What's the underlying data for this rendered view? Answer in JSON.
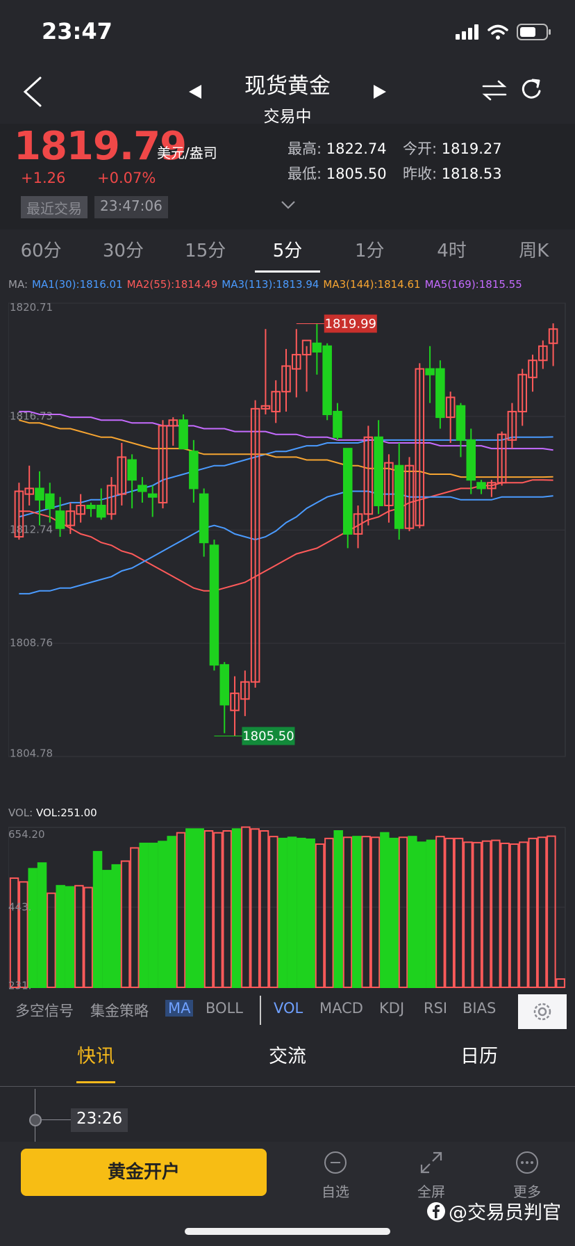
{
  "status_bar": {
    "time": "23:47"
  },
  "nav": {
    "title": "现货黄金",
    "subtitle": "交易中"
  },
  "quote": {
    "price": "1819.79",
    "unit": "美元/盎司",
    "change": "+1.26",
    "change_pct": "+0.07%",
    "last_trade_label": "最近交易",
    "last_trade_time": "23:47:06",
    "high_label": "最高:",
    "high": "1822.74",
    "open_label": "今开:",
    "open": "1819.27",
    "low_label": "最低:",
    "low": "1805.50",
    "prev_close_label": "昨收:",
    "prev_close": "1818.53"
  },
  "timeframes": [
    "60分",
    "30分",
    "15分",
    "5分",
    "1分",
    "4时",
    "周K"
  ],
  "active_timeframe": 3,
  "ma_legend": {
    "prefix": "MA:",
    "items": [
      {
        "text": "MA1(30):1816.01",
        "color": "#4a9bff"
      },
      {
        "text": "MA2(55):1814.49",
        "color": "#ff5a5a"
      },
      {
        "text": "MA3(113):1813.94",
        "color": "#4a9bff"
      },
      {
        "text": "MA3(144):1814.61",
        "color": "#f7a531"
      },
      {
        "text": "MA5(169):1815.55",
        "color": "#c56bff"
      }
    ]
  },
  "chart_data": [
    {
      "type": "candlestick",
      "ylim": [
        1804.78,
        1820.71
      ],
      "y_ticks": [
        "1820.71",
        "1816.73",
        "1812.74",
        "1808.76",
        "1804.78"
      ],
      "y_tick_values": [
        1820.71,
        1816.73,
        1812.74,
        1808.76,
        1804.78
      ],
      "max_label": "1819.99",
      "min_label": "1805.50",
      "max_value": 1819.99,
      "min_value": 1805.5,
      "max_index": 27,
      "min_index": 19,
      "candles": [
        {
          "o": 1812.5,
          "h": 1814.4,
          "l": 1812.4,
          "c": 1814.1
        },
        {
          "o": 1814.0,
          "h": 1815.0,
          "l": 1813.6,
          "c": 1814.2
        },
        {
          "o": 1814.2,
          "h": 1814.8,
          "l": 1812.9,
          "c": 1813.8
        },
        {
          "o": 1814.0,
          "h": 1814.4,
          "l": 1813.0,
          "c": 1813.5
        },
        {
          "o": 1813.4,
          "h": 1813.9,
          "l": 1812.5,
          "c": 1812.8
        },
        {
          "o": 1812.9,
          "h": 1813.7,
          "l": 1812.6,
          "c": 1813.4
        },
        {
          "o": 1813.3,
          "h": 1814.0,
          "l": 1813.0,
          "c": 1813.6
        },
        {
          "o": 1813.6,
          "h": 1813.7,
          "l": 1813.2,
          "c": 1813.5
        },
        {
          "o": 1813.6,
          "h": 1814.2,
          "l": 1813.1,
          "c": 1813.2
        },
        {
          "o": 1813.3,
          "h": 1814.6,
          "l": 1813.1,
          "c": 1814.3
        },
        {
          "o": 1814.0,
          "h": 1815.8,
          "l": 1813.6,
          "c": 1815.3
        },
        {
          "o": 1815.2,
          "h": 1815.4,
          "l": 1813.5,
          "c": 1814.5
        },
        {
          "o": 1814.3,
          "h": 1814.6,
          "l": 1813.7,
          "c": 1814.1
        },
        {
          "o": 1814.0,
          "h": 1814.3,
          "l": 1813.2,
          "c": 1813.9
        },
        {
          "o": 1813.7,
          "h": 1816.6,
          "l": 1813.5,
          "c": 1816.4
        },
        {
          "o": 1816.4,
          "h": 1816.7,
          "l": 1815.7,
          "c": 1816.6
        },
        {
          "o": 1816.6,
          "h": 1816.8,
          "l": 1815.6,
          "c": 1815.6
        },
        {
          "o": 1815.5,
          "h": 1815.9,
          "l": 1813.7,
          "c": 1814.2
        },
        {
          "o": 1814.0,
          "h": 1814.2,
          "l": 1811.8,
          "c": 1812.3
        },
        {
          "o": 1812.2,
          "h": 1812.4,
          "l": 1807.8,
          "c": 1808.0
        },
        {
          "o": 1808.0,
          "h": 1808.1,
          "l": 1805.6,
          "c": 1806.6
        },
        {
          "o": 1806.4,
          "h": 1807.6,
          "l": 1805.5,
          "c": 1807.0
        },
        {
          "o": 1806.8,
          "h": 1807.8,
          "l": 1806.2,
          "c": 1807.4
        },
        {
          "o": 1807.4,
          "h": 1817.3,
          "l": 1807.2,
          "c": 1817.0
        },
        {
          "o": 1817.0,
          "h": 1819.8,
          "l": 1816.8,
          "c": 1817.1
        },
        {
          "o": 1816.9,
          "h": 1818.0,
          "l": 1816.5,
          "c": 1817.6
        },
        {
          "o": 1817.6,
          "h": 1819.1,
          "l": 1816.9,
          "c": 1818.5
        },
        {
          "o": 1818.4,
          "h": 1819.8,
          "l": 1817.4,
          "c": 1818.9
        },
        {
          "o": 1818.9,
          "h": 1819.2,
          "l": 1817.6,
          "c": 1819.4
        },
        {
          "o": 1819.3,
          "h": 1819.99,
          "l": 1818.2,
          "c": 1819.0
        },
        {
          "o": 1819.2,
          "h": 1819.3,
          "l": 1816.6,
          "c": 1816.8
        },
        {
          "o": 1816.9,
          "h": 1817.2,
          "l": 1815.9,
          "c": 1816.0
        },
        {
          "o": 1815.6,
          "h": 1815.6,
          "l": 1812.1,
          "c": 1812.6
        },
        {
          "o": 1812.6,
          "h": 1813.6,
          "l": 1812.1,
          "c": 1813.3
        },
        {
          "o": 1813.3,
          "h": 1816.4,
          "l": 1812.9,
          "c": 1816.0
        },
        {
          "o": 1816.0,
          "h": 1816.6,
          "l": 1813.3,
          "c": 1813.6
        },
        {
          "o": 1813.6,
          "h": 1815.4,
          "l": 1813.0,
          "c": 1815.1
        },
        {
          "o": 1815.0,
          "h": 1815.8,
          "l": 1812.4,
          "c": 1812.8
        },
        {
          "o": 1812.8,
          "h": 1815.3,
          "l": 1812.7,
          "c": 1815.0
        },
        {
          "o": 1812.9,
          "h": 1818.6,
          "l": 1812.8,
          "c": 1818.4
        },
        {
          "o": 1818.4,
          "h": 1819.2,
          "l": 1817.2,
          "c": 1818.2
        },
        {
          "o": 1818.4,
          "h": 1818.7,
          "l": 1816.3,
          "c": 1816.7
        },
        {
          "o": 1816.7,
          "h": 1817.6,
          "l": 1815.8,
          "c": 1817.4
        },
        {
          "o": 1817.1,
          "h": 1817.2,
          "l": 1815.3,
          "c": 1815.9
        },
        {
          "o": 1815.9,
          "h": 1816.3,
          "l": 1814.0,
          "c": 1814.5
        },
        {
          "o": 1814.4,
          "h": 1814.5,
          "l": 1814.0,
          "c": 1814.2
        },
        {
          "o": 1814.2,
          "h": 1814.5,
          "l": 1813.9,
          "c": 1814.4
        },
        {
          "o": 1814.4,
          "h": 1816.2,
          "l": 1814.3,
          "c": 1816.1
        },
        {
          "o": 1815.9,
          "h": 1817.2,
          "l": 1815.6,
          "c": 1816.9
        },
        {
          "o": 1816.9,
          "h": 1818.4,
          "l": 1816.4,
          "c": 1818.2
        },
        {
          "o": 1818.1,
          "h": 1818.9,
          "l": 1817.6,
          "c": 1818.7
        },
        {
          "o": 1818.7,
          "h": 1819.4,
          "l": 1818.4,
          "c": 1819.2
        },
        {
          "o": 1819.3,
          "h": 1820.0,
          "l": 1818.5,
          "c": 1819.8
        }
      ],
      "ma_lines": [
        {
          "name": "MA1(30)",
          "color": "#4a9bff",
          "values": [
            1813.2,
            1813.3,
            1813.4,
            1813.5,
            1813.6,
            1813.7,
            1813.7,
            1813.8,
            1813.8,
            1813.9,
            1814.0,
            1814.1,
            1814.2,
            1814.3,
            1814.5,
            1814.6,
            1814.7,
            1814.8,
            1814.9,
            1815.0,
            1815.0,
            1815.1,
            1815.2,
            1815.3,
            1815.4,
            1815.5,
            1815.5,
            1815.6,
            1815.7,
            1815.7,
            1815.8,
            1815.8,
            1815.8,
            1815.8,
            1815.9,
            1815.9,
            1815.9,
            1815.9,
            1815.9,
            1815.9,
            1815.9,
            1815.9,
            1815.9,
            1815.9,
            1815.9,
            1815.9,
            1815.9,
            1815.9,
            1816.0,
            1816.0,
            1816.0,
            1816.0,
            1816.01
          ]
        },
        {
          "name": "MA2(55)",
          "color": "#ff5a5a",
          "values": [
            1813.4,
            1813.4,
            1813.3,
            1813.2,
            1813.0,
            1812.8,
            1812.6,
            1812.5,
            1812.3,
            1812.2,
            1812.0,
            1811.9,
            1811.7,
            1811.5,
            1811.3,
            1811.1,
            1810.9,
            1810.7,
            1810.6,
            1810.6,
            1810.7,
            1810.8,
            1810.9,
            1811.1,
            1811.3,
            1811.5,
            1811.7,
            1811.9,
            1812.0,
            1812.1,
            1812.3,
            1812.5,
            1812.7,
            1812.9,
            1813.1,
            1813.2,
            1813.4,
            1813.5,
            1813.7,
            1813.8,
            1813.9,
            1814.0,
            1814.1,
            1814.2,
            1814.2,
            1814.3,
            1814.3,
            1814.4,
            1814.4,
            1814.4,
            1814.5,
            1814.5,
            1814.49
          ]
        },
        {
          "name": "MA3(113)",
          "color": "#4a9bff",
          "values": [
            1810.5,
            1810.5,
            1810.6,
            1810.6,
            1810.7,
            1810.7,
            1810.8,
            1810.9,
            1811.0,
            1811.1,
            1811.3,
            1811.4,
            1811.6,
            1811.8,
            1812.0,
            1812.2,
            1812.4,
            1812.6,
            1812.8,
            1812.9,
            1812.8,
            1812.6,
            1812.5,
            1812.4,
            1812.5,
            1812.7,
            1813.0,
            1813.2,
            1813.5,
            1813.7,
            1813.9,
            1814.0,
            1814.1,
            1814.1,
            1814.1,
            1814.0,
            1814.0,
            1814.0,
            1813.9,
            1813.9,
            1813.9,
            1813.9,
            1813.9,
            1813.8,
            1813.8,
            1813.8,
            1813.8,
            1813.9,
            1813.9,
            1813.9,
            1813.9,
            1813.9,
            1813.94
          ]
        },
        {
          "name": "MA3(144)",
          "color": "#f7a531",
          "values": [
            1816.6,
            1816.5,
            1816.5,
            1816.4,
            1816.3,
            1816.3,
            1816.2,
            1816.1,
            1816.0,
            1816.0,
            1815.9,
            1815.8,
            1815.7,
            1815.6,
            1815.6,
            1815.6,
            1815.6,
            1815.5,
            1815.4,
            1815.4,
            1815.4,
            1815.4,
            1815.4,
            1815.4,
            1815.4,
            1815.3,
            1815.3,
            1815.3,
            1815.2,
            1815.2,
            1815.2,
            1815.1,
            1815.0,
            1815.0,
            1814.9,
            1814.9,
            1814.9,
            1814.8,
            1814.8,
            1814.8,
            1814.7,
            1814.7,
            1814.7,
            1814.6,
            1814.6,
            1814.6,
            1814.6,
            1814.6,
            1814.6,
            1814.6,
            1814.6,
            1814.6,
            1814.61
          ]
        },
        {
          "name": "MA5(169)",
          "color": "#c56bff",
          "values": [
            1816.9,
            1816.9,
            1816.8,
            1816.8,
            1816.8,
            1816.7,
            1816.7,
            1816.7,
            1816.6,
            1816.6,
            1816.6,
            1816.5,
            1816.5,
            1816.5,
            1816.4,
            1816.4,
            1816.4,
            1816.4,
            1816.3,
            1816.3,
            1816.3,
            1816.2,
            1816.2,
            1816.2,
            1816.2,
            1816.1,
            1816.1,
            1816.1,
            1816.0,
            1816.0,
            1816.0,
            1815.9,
            1815.9,
            1815.9,
            1815.9,
            1815.9,
            1815.8,
            1815.8,
            1815.8,
            1815.8,
            1815.8,
            1815.7,
            1815.7,
            1815.7,
            1815.7,
            1815.7,
            1815.6,
            1815.6,
            1815.6,
            1815.6,
            1815.6,
            1815.6,
            1815.55
          ]
        }
      ]
    },
    {
      "type": "bar",
      "legend_prefix": "VOL:",
      "legend_value": "VOL:251.00",
      "ylim": [
        231.0,
        654.2
      ],
      "y_ticks": [
        "654.20",
        "443.",
        "231."
      ],
      "y_tick_values": [
        654.2,
        443.0,
        231.0
      ],
      "values": [
        520,
        510,
        545,
        560,
        480,
        500,
        497,
        500,
        495,
        590,
        540,
        555,
        565,
        600,
        612,
        612,
        617,
        630,
        640,
        650,
        650,
        645,
        640,
        645,
        650,
        655,
        650,
        645,
        630,
        625,
        628,
        625,
        623,
        610,
        625,
        645,
        628,
        630,
        630,
        628,
        640,
        625,
        628,
        630,
        615,
        620,
        630,
        625,
        625,
        615,
        614,
        618,
        620,
        612,
        610,
        615,
        625,
        628,
        631,
        253
      ],
      "up": [
        false,
        false,
        true,
        true,
        false,
        true,
        true,
        false,
        false,
        true,
        true,
        true,
        false,
        false,
        true,
        true,
        true,
        true,
        false,
        true,
        true,
        false,
        false,
        false,
        true,
        false,
        false,
        false,
        false,
        true,
        true,
        true,
        true,
        false,
        false,
        true,
        false,
        true,
        false,
        false,
        true,
        true,
        false,
        true,
        true,
        true,
        false,
        false,
        false,
        false,
        false,
        false,
        false,
        false,
        false,
        false,
        false,
        false,
        false,
        false
      ]
    }
  ],
  "indicators": {
    "left": [
      "多空信号",
      "集金策略",
      "MA",
      "BOLL"
    ],
    "right": [
      "VOL",
      "MACD",
      "KDJ",
      "RSI",
      "BIAS"
    ]
  },
  "news_tabs": [
    "快讯",
    "交流",
    "日历"
  ],
  "news": {
    "time": "23:26"
  },
  "bottom_bar": {
    "open_account": "黄金开户",
    "items": [
      "自选",
      "全屏",
      "更多"
    ]
  },
  "watermark": "@交易员判官"
}
